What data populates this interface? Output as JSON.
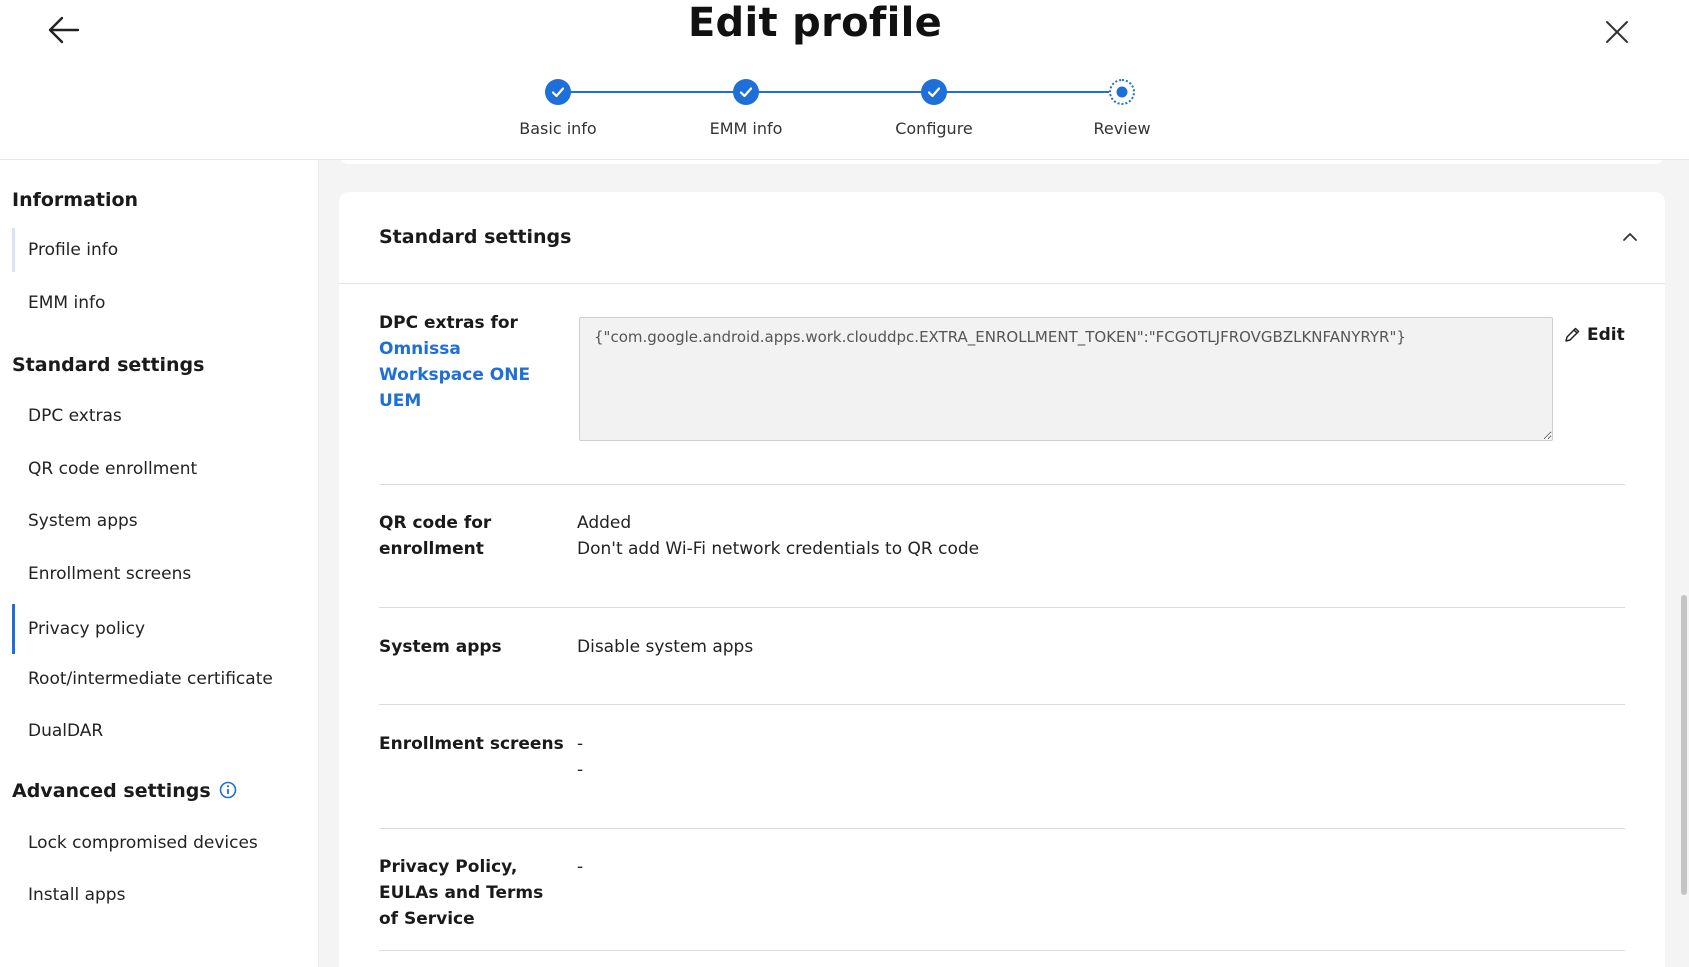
{
  "header": {
    "title": "Edit profile",
    "steps": [
      {
        "label": "Basic info",
        "state": "done"
      },
      {
        "label": "EMM info",
        "state": "done"
      },
      {
        "label": "Configure",
        "state": "done"
      },
      {
        "label": "Review",
        "state": "current"
      }
    ]
  },
  "sidebar": {
    "sections": [
      {
        "heading": "Information",
        "items": [
          "Profile info",
          "EMM info"
        ]
      },
      {
        "heading": "Standard settings",
        "items": [
          "DPC extras",
          "QR code enrollment",
          "System apps",
          "Enrollment screens",
          "Privacy policy",
          "Root/intermediate certificate",
          "DualDAR"
        ]
      },
      {
        "heading": "Advanced settings",
        "items": [
          "Lock compromised devices",
          "Install apps"
        ]
      }
    ]
  },
  "main": {
    "card_title": "Standard settings",
    "dpc": {
      "label_prefix": "DPC extras for",
      "label_link": "Omnissa Workspace ONE UEM",
      "value": "{\"com.google.android.apps.work.clouddpc.EXTRA_ENROLLMENT_TOKEN\":\"FCGOTLJFROVGBZLKNFANYRYR\"}",
      "edit_label": "Edit"
    },
    "qr": {
      "label": "QR code for enrollment",
      "value_line1": "Added",
      "value_line2": "Don't add Wi-Fi network credentials to QR code"
    },
    "system_apps": {
      "label": "System apps",
      "value": "Disable system apps"
    },
    "enrollment_screens": {
      "label": "Enrollment screens",
      "value_line1": "-",
      "value_line2": "-"
    },
    "privacy": {
      "label": "Privacy Policy, EULAs and Terms of Service",
      "value": "-"
    }
  },
  "colors": {
    "accent": "#1e6fd9",
    "background": "#f4f4f4"
  }
}
